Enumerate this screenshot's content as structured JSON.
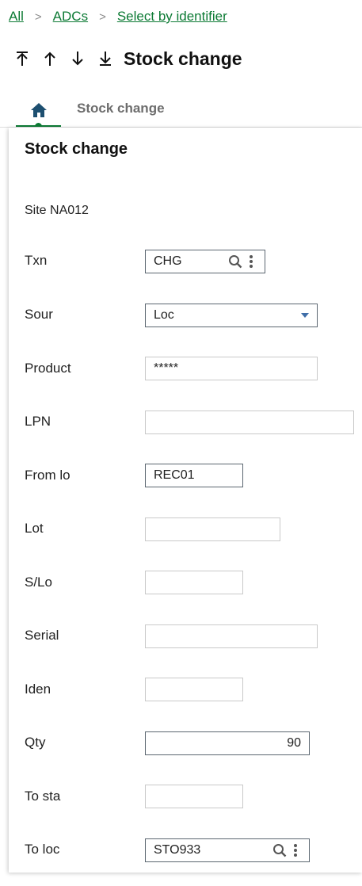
{
  "breadcrumb": {
    "items": [
      "All",
      "ADCs",
      "Select by identifier"
    ],
    "separator": ">"
  },
  "header": {
    "title": "Stock change",
    "nav_icons": [
      "first-record-icon",
      "previous-record-icon",
      "next-record-icon",
      "last-record-icon"
    ]
  },
  "tabs": {
    "home_icon": "home-icon",
    "items": [
      "Stock change"
    ]
  },
  "card": {
    "title": "Stock change",
    "site": "Site NA012",
    "fields": {
      "txn": {
        "label": "Txn",
        "value": "CHG"
      },
      "sour": {
        "label": "Sour",
        "value": "Loc"
      },
      "product": {
        "label": "Product",
        "value": "*****"
      },
      "lpn": {
        "label": "LPN",
        "value": ""
      },
      "from_lo": {
        "label": "From lo",
        "value": "REC01"
      },
      "lot": {
        "label": "Lot",
        "value": ""
      },
      "s_lo": {
        "label": "S/Lo",
        "value": ""
      },
      "serial": {
        "label": "Serial",
        "value": ""
      },
      "iden": {
        "label": "Iden",
        "value": ""
      },
      "qty": {
        "label": "Qty",
        "value": "90"
      },
      "to_sta": {
        "label": "To sta",
        "value": ""
      },
      "to_loc": {
        "label": "To loc",
        "value": "STO933"
      }
    }
  },
  "colors": {
    "link_green": "#0c7a34",
    "caret_blue": "#3f6ea8",
    "home_icon": "#1d4f70",
    "field_border_active": "#5b6670",
    "field_border": "#c9c9c9"
  }
}
